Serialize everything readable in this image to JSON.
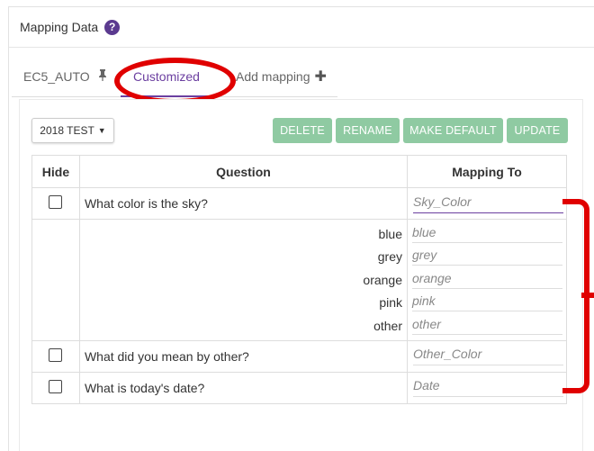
{
  "panel": {
    "title": "Mapping Data",
    "help_glyph": "?"
  },
  "tabs": [
    {
      "label": "EC5_AUTO",
      "icon": "pin-icon"
    },
    {
      "label": "Customized",
      "active": true
    },
    {
      "label": "Add mapping",
      "icon": "plus-icon"
    }
  ],
  "toolbar": {
    "dropdown_label": "2018 TEST",
    "delete_label": "DELETE",
    "rename_label": "RENAME",
    "make_default_label": "MAKE DEFAULT",
    "update_label": "UPDATE"
  },
  "table": {
    "headers": {
      "hide": "Hide",
      "question": "Question",
      "mapping": "Mapping To"
    },
    "q1": {
      "question": "What color is the sky?",
      "mapping": "Sky_Color"
    },
    "answers": [
      {
        "label": "blue",
        "mapping": "blue"
      },
      {
        "label": "grey",
        "mapping": "grey"
      },
      {
        "label": "orange",
        "mapping": "orange"
      },
      {
        "label": "pink",
        "mapping": "pink"
      },
      {
        "label": "other",
        "mapping": "other"
      }
    ],
    "q2": {
      "question": "What did you mean by other?",
      "mapping": "Other_Color"
    },
    "q3": {
      "question": "What is today's date?",
      "mapping": "Date"
    }
  },
  "colors": {
    "accent_purple": "#6b3fa0",
    "button_green": "#8fcaa2",
    "annotation_red": "#e00000"
  }
}
